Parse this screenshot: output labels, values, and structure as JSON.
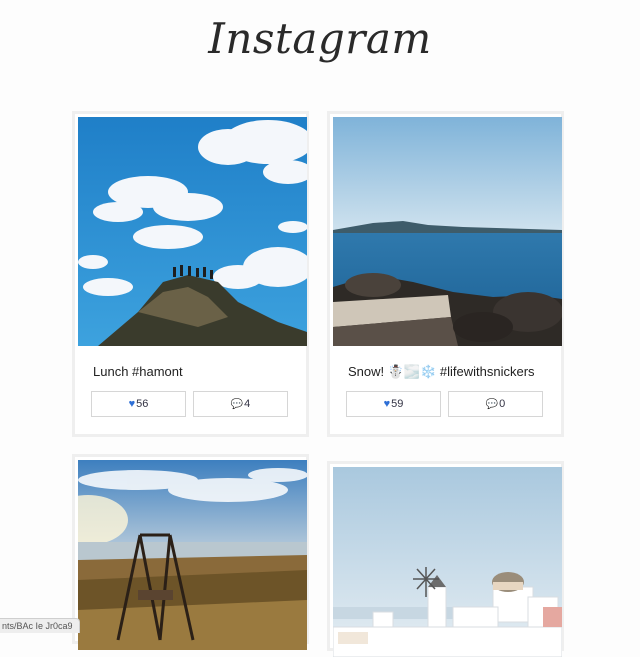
{
  "app": {
    "logo_text": "Instagram"
  },
  "posts": [
    {
      "caption": "Lunch #hamont",
      "likes": "56",
      "comments": "4",
      "like_icon": "heart-icon",
      "comment_icon": "speech-bubble-icon"
    },
    {
      "caption": "Snow! ☃️🌫️❄️ #lifewithsnickers",
      "likes": "59",
      "comments": "0",
      "like_icon": "heart-icon",
      "comment_icon": "speech-bubble-icon"
    },
    {
      "caption": "",
      "likes": "",
      "comments": ""
    },
    {
      "caption": "",
      "likes": "",
      "comments": ""
    }
  ],
  "status_bar": {
    "url_text": "nts/BAc Ie Jr0ca9"
  },
  "colors": {
    "heart": "#2e6fd6",
    "card_border": "#efefef",
    "sky": "#2f8fd0"
  }
}
